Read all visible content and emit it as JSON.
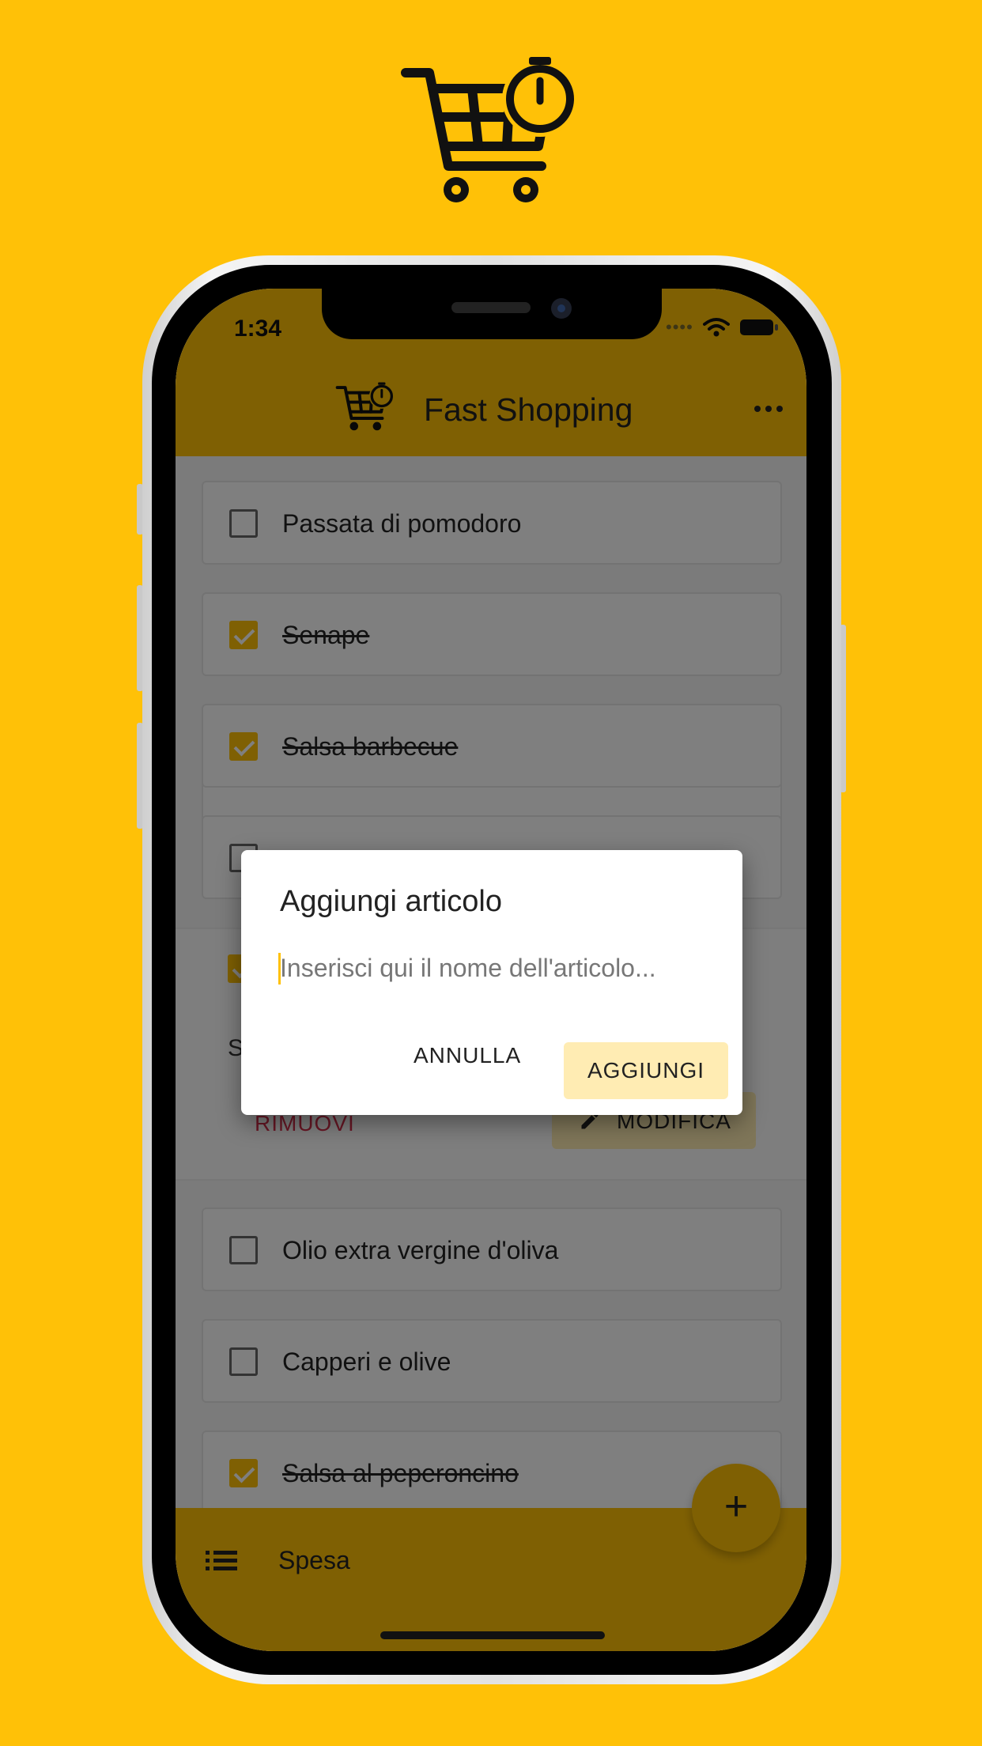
{
  "status": {
    "time": "1:34"
  },
  "appbar": {
    "title": "Fast Shopping"
  },
  "list": {
    "items": [
      {
        "label": "Passata di pomodoro",
        "checked": false
      },
      {
        "label": "Senape",
        "checked": true
      },
      {
        "label": "Salsa barbecue",
        "checked": true
      },
      {
        "label": "",
        "checked": false
      },
      {
        "label": "Olio extra vergine d'oliva",
        "checked": false
      },
      {
        "label": "Capperi e olive",
        "checked": false
      },
      {
        "label": "Salsa al peperoncino",
        "checked": true
      }
    ],
    "expanded": {
      "partial_text": "S",
      "remove_label": "RIMUOVI",
      "edit_label": "MODIFICA"
    }
  },
  "bottombar": {
    "label": "Spesa"
  },
  "fab": {
    "label": "+"
  },
  "dialog": {
    "title": "Aggiungi articolo",
    "input_placeholder": "Inserisci qui il nome dell'articolo...",
    "input_value": "",
    "cancel_label": "ANNULLA",
    "confirm_label": "AGGIUNGI"
  },
  "colors": {
    "accent": "#FFC107",
    "button_bg": "#FFECB3",
    "danger": "#D32F4A"
  }
}
